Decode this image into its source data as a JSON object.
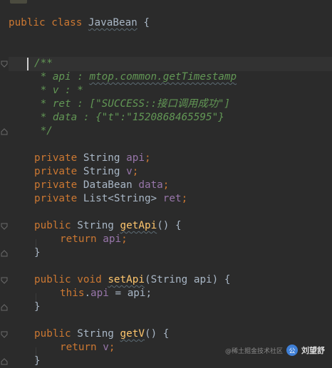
{
  "editor": {
    "class_decl": {
      "keyword1": "public",
      "keyword2": "class",
      "name": "JavaBean",
      "brace": "{"
    },
    "doc_comment": [
      "/**",
      " * api : mtop.common.getTimestamp",
      " * v : *",
      " * ret : [\"SUCCESS::接口调用成功\"]",
      " * data : {\"t\":\"1520868465595\"}",
      " */"
    ],
    "fields": [
      {
        "modifier": "private",
        "type": "String",
        "name": "api"
      },
      {
        "modifier": "private",
        "type": "String",
        "name": "v"
      },
      {
        "modifier": "private",
        "type": "DataBean",
        "name": "data"
      },
      {
        "modifier": "private",
        "type": "List<String>",
        "name": "ret"
      }
    ],
    "methods": {
      "getApi": {
        "modifier": "public",
        "type": "String",
        "name": "getApi",
        "params": "()",
        "open": " {",
        "body_kw": "return",
        "body_field": "api",
        "close": "}"
      },
      "setApi": {
        "modifier": "public",
        "type": "void",
        "name": "setApi",
        "param_type": "String",
        "param_name": "api",
        "body_kw": "this",
        "body_field": "api",
        "body_rest": " = api;",
        "close": "}"
      },
      "getV": {
        "modifier": "public",
        "type": "String",
        "name": "getV",
        "params": "()",
        "open": " {",
        "body_kw": "return",
        "body_field": "v",
        "close": "}"
      }
    },
    "colors": {
      "background": "#2b2b2b",
      "keyword": "#cc7832",
      "doc_comment": "#629755",
      "field": "#9876aa",
      "method": "#ffc66d",
      "text": "#a9b7c6"
    }
  },
  "watermark": {
    "small_text": "@稀土掘金技术社区",
    "logo_text": "公",
    "author": "刘望舒"
  }
}
